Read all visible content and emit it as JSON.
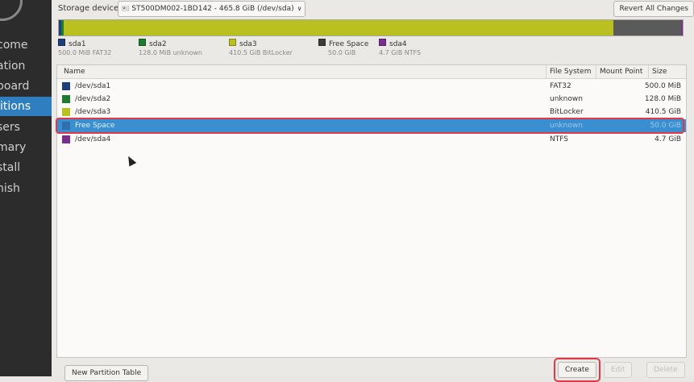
{
  "sidebar": {
    "items": [
      {
        "label": "come"
      },
      {
        "label": "ation"
      },
      {
        "label": "board"
      },
      {
        "label": "itions",
        "active": true
      },
      {
        "label": "sers"
      },
      {
        "label": "mary"
      },
      {
        "label": "stall"
      },
      {
        "label": "nish"
      }
    ]
  },
  "header": {
    "storage_label": "Storage device:",
    "device_value": "ST500DM002-1BD142 - 465.8 GiB (/dev/sda)",
    "revert_label": "Revert All Changes"
  },
  "usage": {
    "segments": [
      {
        "name": "sda1",
        "color": "#1e3f7a",
        "fraction": 0.0015
      },
      {
        "name": "sda2",
        "color": "#1f7a32",
        "fraction": 0.0006
      },
      {
        "name": "sda3",
        "color": "#b9c020",
        "fraction": 0.8814
      },
      {
        "name": "Free Space",
        "color": "#5a5a5a",
        "fraction": 0.1075
      },
      {
        "name": "sda4",
        "color": "#7a2f8e",
        "fraction": 0.0101
      }
    ]
  },
  "legend": [
    {
      "name": "sda1",
      "info": "500.0 MiB  FAT32",
      "color": "#1e3f7a"
    },
    {
      "name": "sda2",
      "info": "128.0 MiB  unknown",
      "color": "#1f7a32"
    },
    {
      "name": "sda3",
      "info": "410.5 GiB  BitLocker",
      "color": "#b9c020"
    },
    {
      "name": "Free Space",
      "info": "50.0 GiB",
      "color": "#3c3c3c"
    },
    {
      "name": "sda4",
      "info": "4.7 GiB  NTFS",
      "color": "#7a2f8e"
    }
  ],
  "table": {
    "headers": {
      "name": "Name",
      "filesystem": "File System",
      "mount": "Mount Point",
      "size": "Size"
    },
    "rows": [
      {
        "name": "/dev/sda1",
        "fs": "FAT32",
        "size": "500.0 MiB",
        "color": "#1e3f7a"
      },
      {
        "name": "/dev/sda2",
        "fs": "unknown",
        "size": "128.0 MiB",
        "color": "#1f7a32"
      },
      {
        "name": "/dev/sda3",
        "fs": "BitLocker",
        "size": "410.5 GiB",
        "color": "#b9c020"
      },
      {
        "name": "Free Space",
        "fs": "unknown",
        "size": "50.0 GiB",
        "color": "#3a8fd0",
        "selected": true
      },
      {
        "name": "/dev/sda4",
        "fs": "NTFS",
        "size": "4.7 GiB",
        "color": "#7a2f8e"
      }
    ]
  },
  "buttons": {
    "new_table": "New Partition Table",
    "create": "Create",
    "edit": "Edit",
    "delete": "Delete"
  }
}
